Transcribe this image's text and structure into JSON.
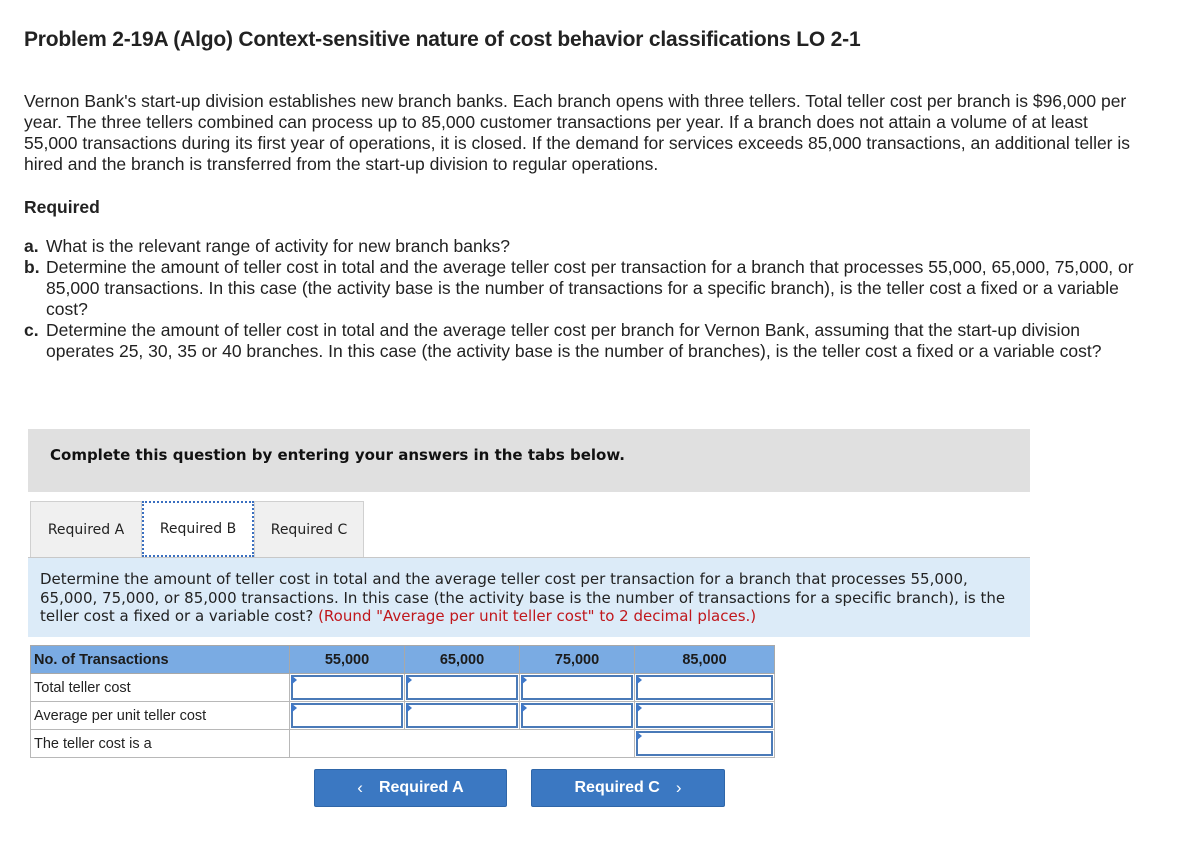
{
  "title": "Problem 2-19A (Algo) Context-sensitive nature of cost behavior classifications LO 2-1",
  "intro": "Vernon Bank's start-up division establishes new branch banks. Each branch opens with three tellers. Total teller cost per branch is $96,000 per year. The three tellers combined can process up to 85,000 customer transactions per year. If a branch does not attain a volume of at least 55,000 transactions during its first year of operations, it is closed. If the demand for services exceeds 85,000 transactions, an additional teller is hired and the branch is transferred from the start-up division to regular operations.",
  "required": {
    "heading": "Required",
    "items": [
      {
        "label": "a.",
        "text": "What is the relevant range of activity for new branch banks?"
      },
      {
        "label": "b.",
        "text": "Determine the amount of teller cost in total and the average teller cost per transaction for a branch that processes 55,000, 65,000, 75,000, or 85,000 transactions. In this case (the activity base is the number of transactions for a specific branch), is the teller cost a fixed or a variable cost?"
      },
      {
        "label": "c.",
        "text": "Determine the amount of teller cost in total and the average teller cost per branch for Vernon Bank, assuming that the start-up division operates 25, 30, 35 or 40 branches. In this case (the activity base is the number of branches), is the teller cost a fixed or a variable cost?"
      }
    ]
  },
  "banner": "Complete this question by entering your answers in the tabs below.",
  "tabs": [
    {
      "label": "Required A",
      "active": false
    },
    {
      "label": "Required B",
      "active": true
    },
    {
      "label": "Required C",
      "active": false
    }
  ],
  "instruction": {
    "text": "Determine the amount of teller cost in total and the average teller cost per transaction for a branch that processes 55,000, 65,000, 75,000, or 85,000 transactions. In this case (the activity base is the number of transactions for a specific branch), is the teller cost a fixed or a variable cost?",
    "note": "(Round \"Average per unit teller cost\" to 2 decimal places.)"
  },
  "table": {
    "header": "No. of Transactions",
    "columns": [
      "55,000",
      "65,000",
      "75,000",
      "85,000"
    ],
    "rows": [
      {
        "label": "Total teller cost",
        "values": [
          "",
          "",
          "",
          ""
        ]
      },
      {
        "label": "Average per unit teller cost",
        "values": [
          "",
          "",
          "",
          ""
        ]
      },
      {
        "label": "The teller cost is a",
        "value": ""
      }
    ]
  },
  "nav": {
    "prev_label": "Required A",
    "next_label": "Required C",
    "prev_icon": "‹",
    "next_icon": "›"
  }
}
